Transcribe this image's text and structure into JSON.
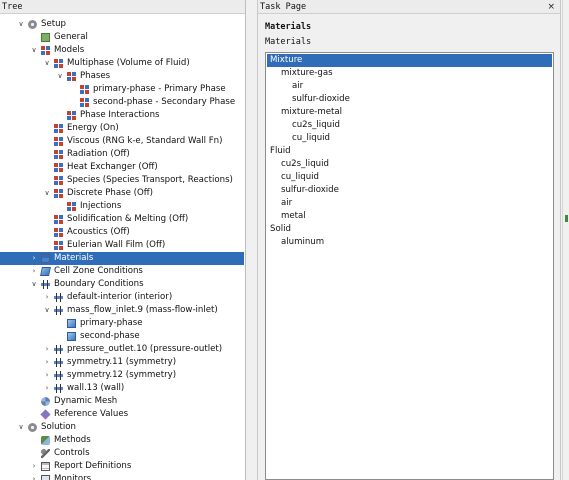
{
  "tree_pane": {
    "title": "Tree",
    "rows": [
      {
        "label": "Setup",
        "depth": 0,
        "arrow": "down",
        "icon": "gear-icon",
        "cls": "ic-gear"
      },
      {
        "label": "General",
        "depth": 1,
        "arrow": "",
        "icon": "general-icon",
        "cls": "ic-cube"
      },
      {
        "label": "Models",
        "depth": 1,
        "arrow": "down",
        "icon": "models-icon",
        "cls": "ic-model"
      },
      {
        "label": "Multiphase (Volume of Fluid)",
        "depth": 2,
        "arrow": "down",
        "icon": "model-icon",
        "cls": "ic-model"
      },
      {
        "label": "Phases",
        "depth": 3,
        "arrow": "down",
        "icon": "phases-icon",
        "cls": "ic-model"
      },
      {
        "label": "primary-phase - Primary Phase",
        "depth": 4,
        "arrow": "",
        "icon": "phase-icon",
        "cls": "ic-model"
      },
      {
        "label": "second-phase - Secondary Phase",
        "depth": 4,
        "arrow": "",
        "icon": "phase-icon",
        "cls": "ic-model"
      },
      {
        "label": "Phase Interactions",
        "depth": 3,
        "arrow": "",
        "icon": "model-icon",
        "cls": "ic-model"
      },
      {
        "label": "Energy (On)",
        "depth": 2,
        "arrow": "",
        "icon": "model-icon",
        "cls": "ic-model"
      },
      {
        "label": "Viscous (RNG k-e, Standard Wall Fn)",
        "depth": 2,
        "arrow": "",
        "icon": "model-icon",
        "cls": "ic-model"
      },
      {
        "label": "Radiation (Off)",
        "depth": 2,
        "arrow": "",
        "icon": "model-icon",
        "cls": "ic-model"
      },
      {
        "label": "Heat Exchanger (Off)",
        "depth": 2,
        "arrow": "",
        "icon": "model-icon",
        "cls": "ic-model"
      },
      {
        "label": "Species (Species Transport, Reactions)",
        "depth": 2,
        "arrow": "",
        "icon": "model-icon",
        "cls": "ic-model"
      },
      {
        "label": "Discrete Phase (Off)",
        "depth": 2,
        "arrow": "down",
        "icon": "model-icon",
        "cls": "ic-model"
      },
      {
        "label": "Injections",
        "depth": 3,
        "arrow": "",
        "icon": "model-icon",
        "cls": "ic-model"
      },
      {
        "label": "Solidification & Melting (Off)",
        "depth": 2,
        "arrow": "",
        "icon": "model-icon",
        "cls": "ic-model"
      },
      {
        "label": "Acoustics (Off)",
        "depth": 2,
        "arrow": "",
        "icon": "model-icon",
        "cls": "ic-model"
      },
      {
        "label": "Eulerian Wall Film (Off)",
        "depth": 2,
        "arrow": "",
        "icon": "model-icon",
        "cls": "ic-model"
      },
      {
        "label": "Materials",
        "depth": 1,
        "arrow": "right",
        "icon": "flask-icon",
        "cls": "ic-flask",
        "selected": true
      },
      {
        "label": "Cell Zone Conditions",
        "depth": 1,
        "arrow": "right",
        "icon": "zone-icon",
        "cls": "ic-zone"
      },
      {
        "label": "Boundary Conditions",
        "depth": 1,
        "arrow": "down",
        "icon": "boundary-icon",
        "cls": "ic-bc"
      },
      {
        "label": "default-interior (interior)",
        "depth": 2,
        "arrow": "right",
        "icon": "boundary-icon",
        "cls": "ic-bc"
      },
      {
        "label": "mass_flow_inlet.9 (mass-flow-inlet)",
        "depth": 2,
        "arrow": "down",
        "icon": "boundary-icon",
        "cls": "ic-bc"
      },
      {
        "label": "primary-phase",
        "depth": 3,
        "arrow": "",
        "icon": "phase-icon",
        "cls": "ic-phase"
      },
      {
        "label": "second-phase",
        "depth": 3,
        "arrow": "",
        "icon": "phase-icon",
        "cls": "ic-phase"
      },
      {
        "label": "pressure_outlet.10 (pressure-outlet)",
        "depth": 2,
        "arrow": "right",
        "icon": "boundary-icon",
        "cls": "ic-bc"
      },
      {
        "label": "symmetry.11 (symmetry)",
        "depth": 2,
        "arrow": "right",
        "icon": "boundary-icon",
        "cls": "ic-bc"
      },
      {
        "label": "symmetry.12 (symmetry)",
        "depth": 2,
        "arrow": "right",
        "icon": "boundary-icon",
        "cls": "ic-bc"
      },
      {
        "label": "wall.13 (wall)",
        "depth": 2,
        "arrow": "right",
        "icon": "boundary-icon",
        "cls": "ic-bc"
      },
      {
        "label": "Dynamic Mesh",
        "depth": 1,
        "arrow": "",
        "icon": "mesh-icon",
        "cls": "ic-mesh"
      },
      {
        "label": "Reference Values",
        "depth": 1,
        "arrow": "",
        "icon": "reference-icon",
        "cls": "ic-ref"
      },
      {
        "label": "Solution",
        "depth": 0,
        "arrow": "down",
        "icon": "gear-icon",
        "cls": "ic-gear"
      },
      {
        "label": "Methods",
        "depth": 1,
        "arrow": "",
        "icon": "methods-icon",
        "cls": "ic-methods"
      },
      {
        "label": "Controls",
        "depth": 1,
        "arrow": "",
        "icon": "controls-icon",
        "cls": "ic-controls"
      },
      {
        "label": "Report Definitions",
        "depth": 1,
        "arrow": "right",
        "icon": "report-icon",
        "cls": "ic-report"
      },
      {
        "label": "Monitors",
        "depth": 1,
        "arrow": "right",
        "icon": "monitor-icon",
        "cls": "ic-monitor"
      }
    ]
  },
  "task_page": {
    "header": "Task Page",
    "close_label": "×",
    "title": "Materials",
    "subtitle": "Materials",
    "materials": [
      {
        "label": "Mixture",
        "depth": 0,
        "selected": true
      },
      {
        "label": "mixture-gas",
        "depth": 1
      },
      {
        "label": "air",
        "depth": 2
      },
      {
        "label": "sulfur-dioxide",
        "depth": 2
      },
      {
        "label": "mixture-metal",
        "depth": 1
      },
      {
        "label": "cu2s_liquid",
        "depth": 2
      },
      {
        "label": "cu_liquid",
        "depth": 2
      },
      {
        "label": "Fluid",
        "depth": 0
      },
      {
        "label": "cu2s_liquid",
        "depth": 1
      },
      {
        "label": "cu_liquid",
        "depth": 1
      },
      {
        "label": "sulfur-dioxide",
        "depth": 1
      },
      {
        "label": "air",
        "depth": 1
      },
      {
        "label": "metal",
        "depth": 1
      },
      {
        "label": "Solid",
        "depth": 0
      },
      {
        "label": "aluminum",
        "depth": 1
      }
    ]
  },
  "colors": {
    "selection": "#2f6db8",
    "panel_bg": "#f0f0f0",
    "list_bg": "#ffffff"
  }
}
